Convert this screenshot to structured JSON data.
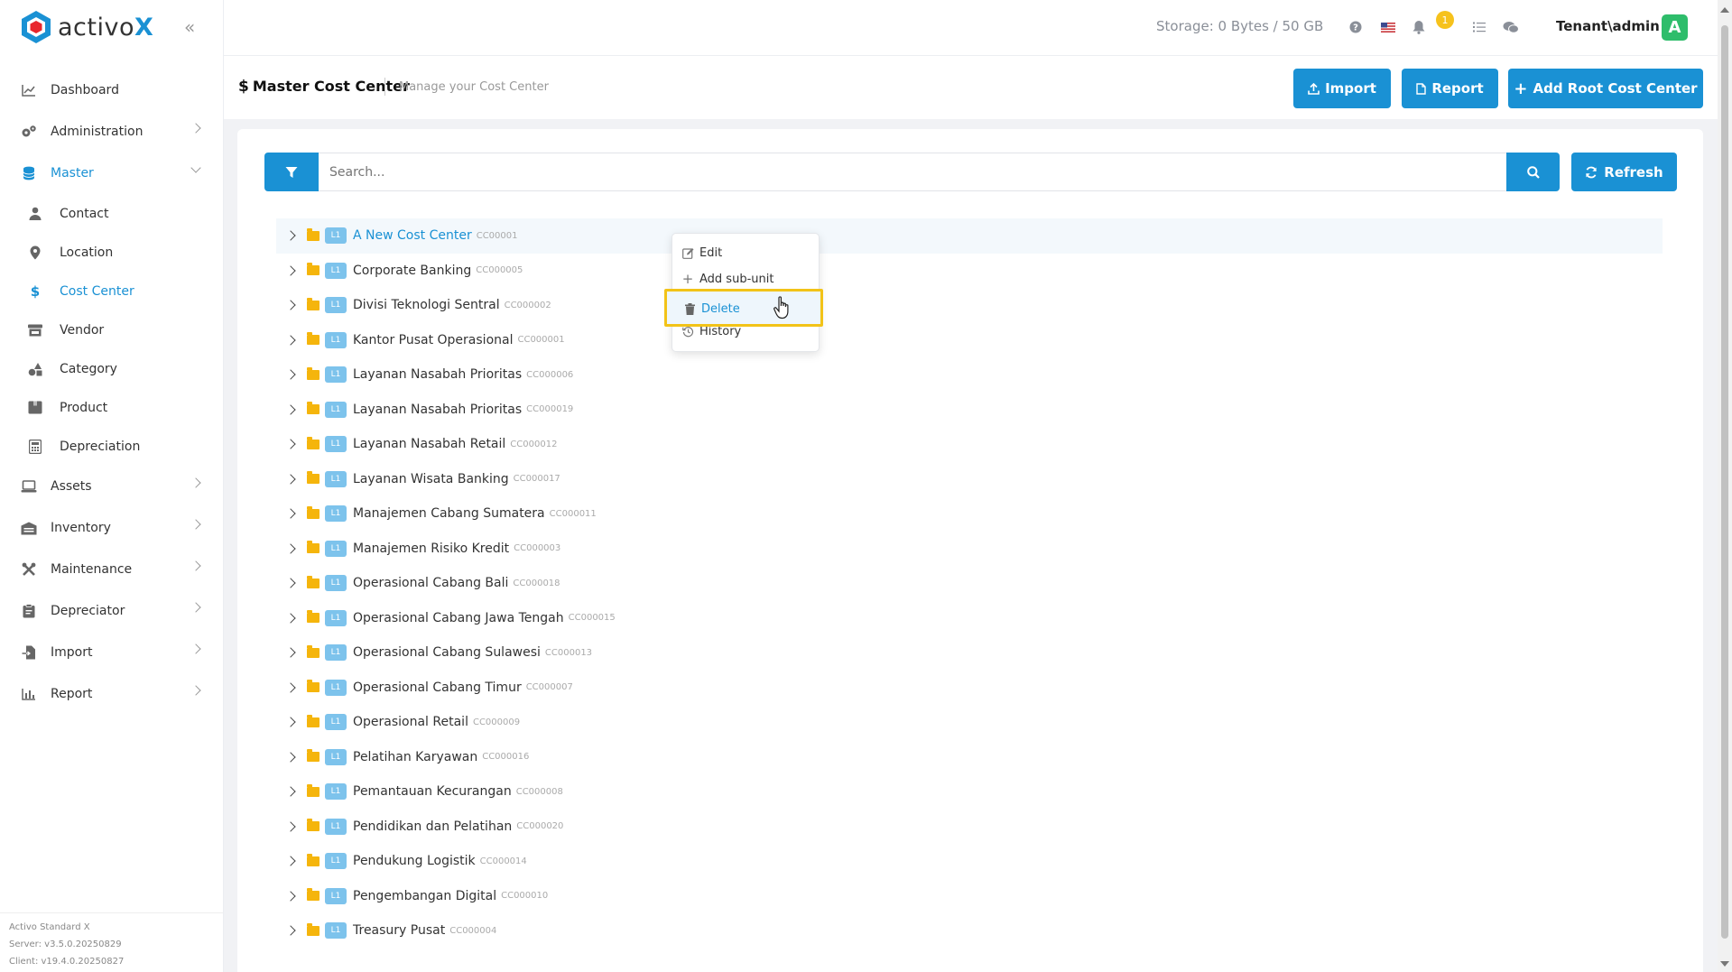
{
  "app": {
    "logo_text_a": "activo",
    "logo_text_b": "X"
  },
  "sidebar": {
    "items": [
      {
        "label": "Dashboard"
      },
      {
        "label": "Administration"
      },
      {
        "label": "Master"
      },
      {
        "label": "Assets"
      },
      {
        "label": "Inventory"
      },
      {
        "label": "Maintenance"
      },
      {
        "label": "Depreciator"
      },
      {
        "label": "Import"
      },
      {
        "label": "Report"
      }
    ],
    "master_sub": [
      {
        "label": "Contact"
      },
      {
        "label": "Location"
      },
      {
        "label": "Cost Center"
      },
      {
        "label": "Vendor"
      },
      {
        "label": "Category"
      },
      {
        "label": "Product"
      },
      {
        "label": "Depreciation"
      }
    ],
    "footer": {
      "edition": "Activo Standard X",
      "server": "Server: v3.5.0.20250829",
      "client": "Client: v19.4.0.20250827"
    }
  },
  "topbar": {
    "storage": "Storage: 0 Bytes / 50 GB",
    "notification_count": "1",
    "user": "Tenant\\admin",
    "avatar_letter": "A"
  },
  "header": {
    "title": "Master Cost Center",
    "subtitle": "Manage your Cost Center",
    "import_label": "Import",
    "report_label": "Report",
    "add_root_label": "Add Root Cost Center"
  },
  "search": {
    "placeholder": "Search...",
    "refresh_label": "Refresh"
  },
  "tree": [
    {
      "level": "L1",
      "name": "A New Cost Center",
      "code": "CC00001"
    },
    {
      "level": "L1",
      "name": "Corporate Banking",
      "code": "CC000005"
    },
    {
      "level": "L1",
      "name": "Divisi Teknologi Sentral",
      "code": "CC000002"
    },
    {
      "level": "L1",
      "name": "Kantor Pusat Operasional",
      "code": "CC000001"
    },
    {
      "level": "L1",
      "name": "Layanan Nasabah Prioritas",
      "code": "CC000006"
    },
    {
      "level": "L1",
      "name": "Layanan Nasabah Prioritas",
      "code": "CC000019"
    },
    {
      "level": "L1",
      "name": "Layanan Nasabah Retail",
      "code": "CC000012"
    },
    {
      "level": "L1",
      "name": "Layanan Wisata Banking",
      "code": "CC000017"
    },
    {
      "level": "L1",
      "name": "Manajemen Cabang Sumatera",
      "code": "CC000011"
    },
    {
      "level": "L1",
      "name": "Manajemen Risiko Kredit",
      "code": "CC000003"
    },
    {
      "level": "L1",
      "name": "Operasional Cabang Bali",
      "code": "CC000018"
    },
    {
      "level": "L1",
      "name": "Operasional Cabang Jawa Tengah",
      "code": "CC000015"
    },
    {
      "level": "L1",
      "name": "Operasional Cabang Sulawesi",
      "code": "CC000013"
    },
    {
      "level": "L1",
      "name": "Operasional Cabang Timur",
      "code": "CC000007"
    },
    {
      "level": "L1",
      "name": "Operasional Retail",
      "code": "CC000009"
    },
    {
      "level": "L1",
      "name": "Pelatihan Karyawan",
      "code": "CC000016"
    },
    {
      "level": "L1",
      "name": "Pemantauan Kecurangan",
      "code": "CC000008"
    },
    {
      "level": "L1",
      "name": "Pendidikan dan Pelatihan",
      "code": "CC000020"
    },
    {
      "level": "L1",
      "name": "Pendukung Logistik",
      "code": "CC000014"
    },
    {
      "level": "L1",
      "name": "Pengembangan Digital",
      "code": "CC000010"
    },
    {
      "level": "L1",
      "name": "Treasury Pusat",
      "code": "CC000004"
    }
  ],
  "context_menu": {
    "edit": "Edit",
    "add_sub_unit": "Add sub-unit",
    "delete": "Delete",
    "history": "History"
  },
  "colors": {
    "primary": "#1a91d4",
    "highlight_border": "#f2c318",
    "folder": "#f5b50c",
    "level_badge": "#7dc3ec"
  }
}
